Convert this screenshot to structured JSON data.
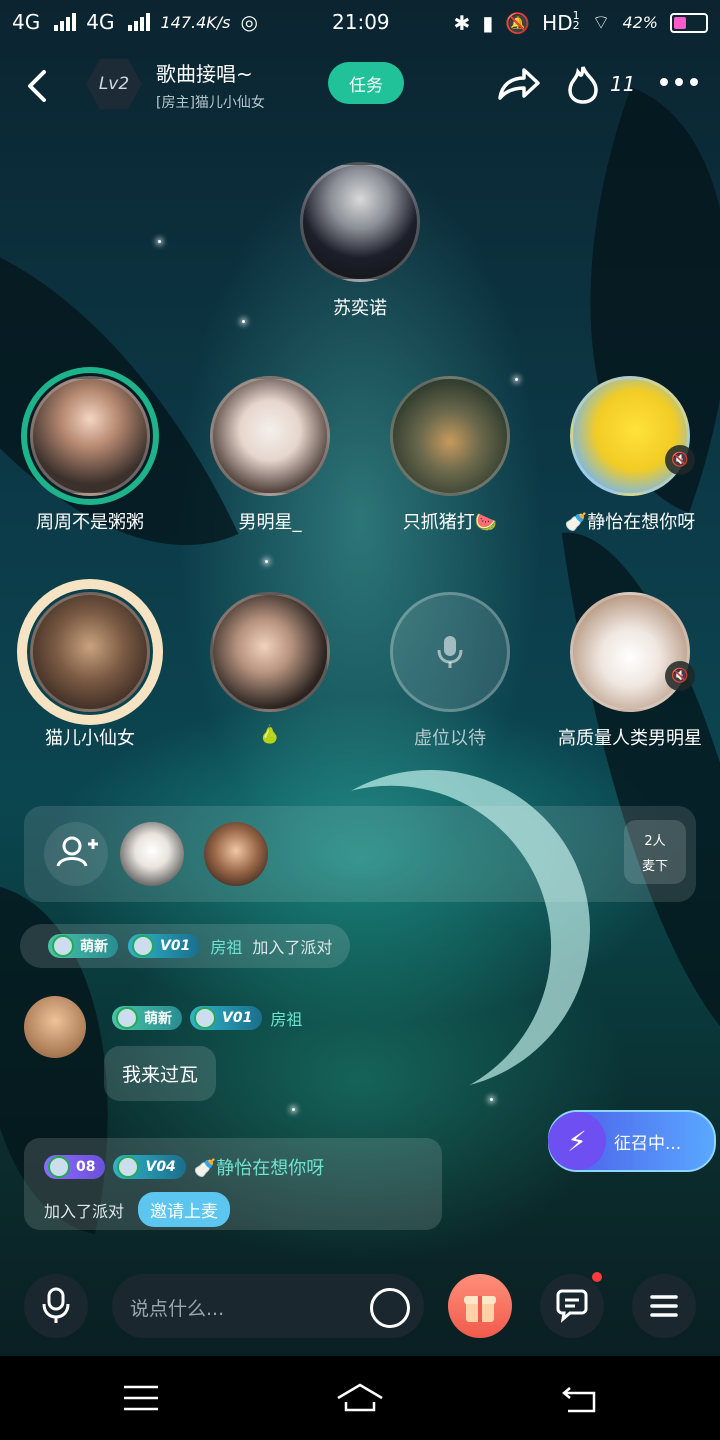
{
  "status_bar": {
    "network_1": "4G",
    "network_2": "4G",
    "speed": "147.4K/s",
    "time": "21:09",
    "hd": "HD",
    "hd_sub": "1",
    "hd_sub2": "2",
    "battery": "42%"
  },
  "header": {
    "level": "Lv2",
    "room_title": "歌曲接唱~",
    "host_label": "[房主]猫儿小仙女",
    "task_button": "任务",
    "heat_value": "11"
  },
  "seats": [
    {
      "name": "苏奕诺"
    },
    {
      "name": "周周不是粥粥"
    },
    {
      "name": "男明星_"
    },
    {
      "name": "只抓猪打🍉"
    },
    {
      "name": "🍼静怡在想你呀"
    },
    {
      "name": "猫儿小仙女"
    },
    {
      "name": "🍐"
    },
    {
      "name": "虚位以待"
    },
    {
      "name": "高质量人类男明星"
    }
  ],
  "queue": {
    "count_label": "2人",
    "down_label": "麦下"
  },
  "messages": {
    "system": {
      "badge1": "萌新",
      "badge2": "V01",
      "user": "房祖",
      "text": "加入了派对"
    },
    "chat": {
      "badge1": "萌新",
      "badge2": "V01",
      "user": "房祖",
      "text": "我来过瓦"
    },
    "join": {
      "badge1": "08",
      "badge2": "V04",
      "user": "🍼静怡在想你呀",
      "text": "加入了派对",
      "invite_button": "邀请上麦"
    }
  },
  "recruit_button": "征召中...",
  "input": {
    "placeholder": "说点什么..."
  },
  "colors": {
    "accent": "#21c29a",
    "recruit": "#4b59e8",
    "invite": "#5cc6f0",
    "gift": "#f15a4c"
  }
}
